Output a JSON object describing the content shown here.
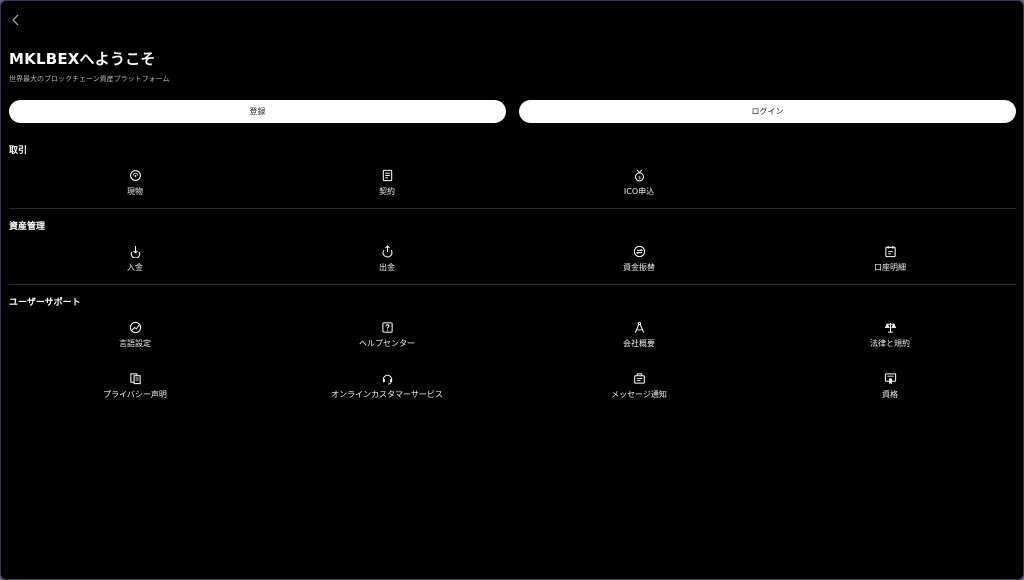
{
  "header": {
    "title": "MKLBEXへようこそ",
    "subtitle": "世界最大のブロックチェーン資産プラットフォーム"
  },
  "auth": {
    "register_label": "登録",
    "login_label": "ログイン"
  },
  "sections": {
    "trade": {
      "title": "取引",
      "items": [
        {
          "label": "現物",
          "icon": "spot-icon"
        },
        {
          "label": "契約",
          "icon": "contract-icon"
        },
        {
          "label": "ICO申込",
          "icon": "medal-icon"
        }
      ]
    },
    "assets": {
      "title": "資産管理",
      "items": [
        {
          "label": "入金",
          "icon": "deposit-icon"
        },
        {
          "label": "出金",
          "icon": "withdraw-icon"
        },
        {
          "label": "資金振替",
          "icon": "transfer-icon"
        },
        {
          "label": "口座明細",
          "icon": "statement-icon"
        }
      ]
    },
    "support": {
      "title": "ユーザーサポート",
      "items": [
        {
          "label": "言語設定",
          "icon": "language-icon"
        },
        {
          "label": "ヘルプセンター",
          "icon": "help-icon"
        },
        {
          "label": "会社概要",
          "icon": "compass-icon"
        },
        {
          "label": "法律と規約",
          "icon": "scales-icon"
        },
        {
          "label": "プライバシー声明",
          "icon": "privacy-icon"
        },
        {
          "label": "オンラインカスタマーサービス",
          "icon": "headset-icon"
        },
        {
          "label": "メッセージ通知",
          "icon": "message-icon"
        },
        {
          "label": "資格",
          "icon": "certificate-icon"
        }
      ]
    }
  },
  "colors": {
    "background": "#000000",
    "text": "#ffffff",
    "button_bg": "#ffffff",
    "button_text": "#222222"
  }
}
